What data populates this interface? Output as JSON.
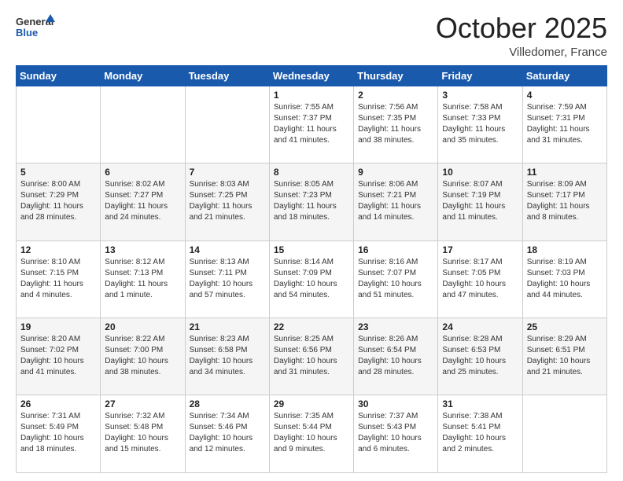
{
  "header": {
    "logo_general": "General",
    "logo_blue": "Blue",
    "month_title": "October 2025",
    "location": "Villedomer, France"
  },
  "calendar": {
    "days_of_week": [
      "Sunday",
      "Monday",
      "Tuesday",
      "Wednesday",
      "Thursday",
      "Friday",
      "Saturday"
    ],
    "weeks": [
      [
        {
          "day": "",
          "info": ""
        },
        {
          "day": "",
          "info": ""
        },
        {
          "day": "",
          "info": ""
        },
        {
          "day": "1",
          "info": "Sunrise: 7:55 AM\nSunset: 7:37 PM\nDaylight: 11 hours and 41 minutes."
        },
        {
          "day": "2",
          "info": "Sunrise: 7:56 AM\nSunset: 7:35 PM\nDaylight: 11 hours and 38 minutes."
        },
        {
          "day": "3",
          "info": "Sunrise: 7:58 AM\nSunset: 7:33 PM\nDaylight: 11 hours and 35 minutes."
        },
        {
          "day": "4",
          "info": "Sunrise: 7:59 AM\nSunset: 7:31 PM\nDaylight: 11 hours and 31 minutes."
        }
      ],
      [
        {
          "day": "5",
          "info": "Sunrise: 8:00 AM\nSunset: 7:29 PM\nDaylight: 11 hours and 28 minutes."
        },
        {
          "day": "6",
          "info": "Sunrise: 8:02 AM\nSunset: 7:27 PM\nDaylight: 11 hours and 24 minutes."
        },
        {
          "day": "7",
          "info": "Sunrise: 8:03 AM\nSunset: 7:25 PM\nDaylight: 11 hours and 21 minutes."
        },
        {
          "day": "8",
          "info": "Sunrise: 8:05 AM\nSunset: 7:23 PM\nDaylight: 11 hours and 18 minutes."
        },
        {
          "day": "9",
          "info": "Sunrise: 8:06 AM\nSunset: 7:21 PM\nDaylight: 11 hours and 14 minutes."
        },
        {
          "day": "10",
          "info": "Sunrise: 8:07 AM\nSunset: 7:19 PM\nDaylight: 11 hours and 11 minutes."
        },
        {
          "day": "11",
          "info": "Sunrise: 8:09 AM\nSunset: 7:17 PM\nDaylight: 11 hours and 8 minutes."
        }
      ],
      [
        {
          "day": "12",
          "info": "Sunrise: 8:10 AM\nSunset: 7:15 PM\nDaylight: 11 hours and 4 minutes."
        },
        {
          "day": "13",
          "info": "Sunrise: 8:12 AM\nSunset: 7:13 PM\nDaylight: 11 hours and 1 minute."
        },
        {
          "day": "14",
          "info": "Sunrise: 8:13 AM\nSunset: 7:11 PM\nDaylight: 10 hours and 57 minutes."
        },
        {
          "day": "15",
          "info": "Sunrise: 8:14 AM\nSunset: 7:09 PM\nDaylight: 10 hours and 54 minutes."
        },
        {
          "day": "16",
          "info": "Sunrise: 8:16 AM\nSunset: 7:07 PM\nDaylight: 10 hours and 51 minutes."
        },
        {
          "day": "17",
          "info": "Sunrise: 8:17 AM\nSunset: 7:05 PM\nDaylight: 10 hours and 47 minutes."
        },
        {
          "day": "18",
          "info": "Sunrise: 8:19 AM\nSunset: 7:03 PM\nDaylight: 10 hours and 44 minutes."
        }
      ],
      [
        {
          "day": "19",
          "info": "Sunrise: 8:20 AM\nSunset: 7:02 PM\nDaylight: 10 hours and 41 minutes."
        },
        {
          "day": "20",
          "info": "Sunrise: 8:22 AM\nSunset: 7:00 PM\nDaylight: 10 hours and 38 minutes."
        },
        {
          "day": "21",
          "info": "Sunrise: 8:23 AM\nSunset: 6:58 PM\nDaylight: 10 hours and 34 minutes."
        },
        {
          "day": "22",
          "info": "Sunrise: 8:25 AM\nSunset: 6:56 PM\nDaylight: 10 hours and 31 minutes."
        },
        {
          "day": "23",
          "info": "Sunrise: 8:26 AM\nSunset: 6:54 PM\nDaylight: 10 hours and 28 minutes."
        },
        {
          "day": "24",
          "info": "Sunrise: 8:28 AM\nSunset: 6:53 PM\nDaylight: 10 hours and 25 minutes."
        },
        {
          "day": "25",
          "info": "Sunrise: 8:29 AM\nSunset: 6:51 PM\nDaylight: 10 hours and 21 minutes."
        }
      ],
      [
        {
          "day": "26",
          "info": "Sunrise: 7:31 AM\nSunset: 5:49 PM\nDaylight: 10 hours and 18 minutes."
        },
        {
          "day": "27",
          "info": "Sunrise: 7:32 AM\nSunset: 5:48 PM\nDaylight: 10 hours and 15 minutes."
        },
        {
          "day": "28",
          "info": "Sunrise: 7:34 AM\nSunset: 5:46 PM\nDaylight: 10 hours and 12 minutes."
        },
        {
          "day": "29",
          "info": "Sunrise: 7:35 AM\nSunset: 5:44 PM\nDaylight: 10 hours and 9 minutes."
        },
        {
          "day": "30",
          "info": "Sunrise: 7:37 AM\nSunset: 5:43 PM\nDaylight: 10 hours and 6 minutes."
        },
        {
          "day": "31",
          "info": "Sunrise: 7:38 AM\nSunset: 5:41 PM\nDaylight: 10 hours and 2 minutes."
        },
        {
          "day": "",
          "info": ""
        }
      ]
    ]
  }
}
